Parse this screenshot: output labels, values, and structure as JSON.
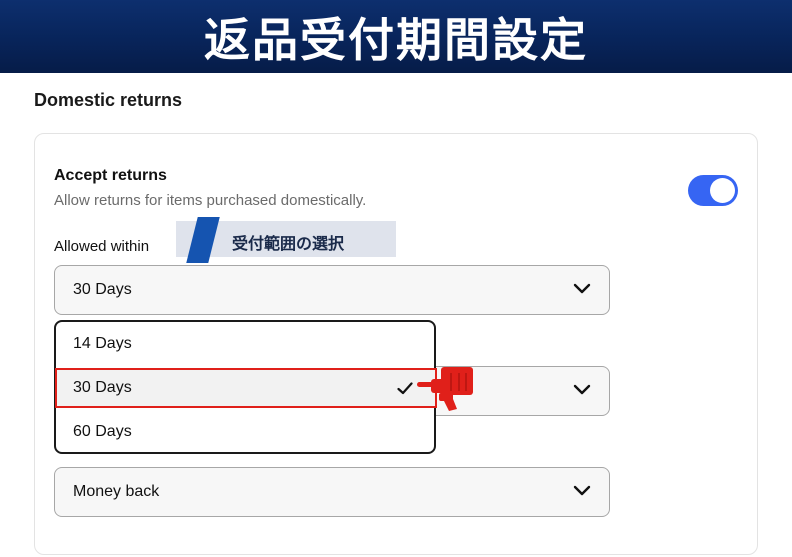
{
  "banner": {
    "title": "返品受付期間設定"
  },
  "section": {
    "heading": "Domestic returns"
  },
  "accept": {
    "title": "Accept returns",
    "description": "Allow returns for items purchased domestically.",
    "toggle_on": true
  },
  "allowed_within": {
    "label": "Allowed within",
    "value": "30 Days",
    "options": [
      {
        "label": "14 Days",
        "selected": false
      },
      {
        "label": "30 Days",
        "selected": true
      },
      {
        "label": "60 Days",
        "selected": false
      }
    ]
  },
  "annotation": {
    "text": "受付範囲の選択"
  },
  "refund_method": {
    "value": "Money back"
  },
  "colors": {
    "banner": "#08245a",
    "toggle": "#3665f3",
    "highlight": "#e0201a",
    "annotation_stripe": "#1554b0"
  },
  "icons": {
    "chevron": "chevron-down-icon",
    "check": "check-icon",
    "pointer": "hand-pointer-icon",
    "toggle": "toggle-switch"
  }
}
